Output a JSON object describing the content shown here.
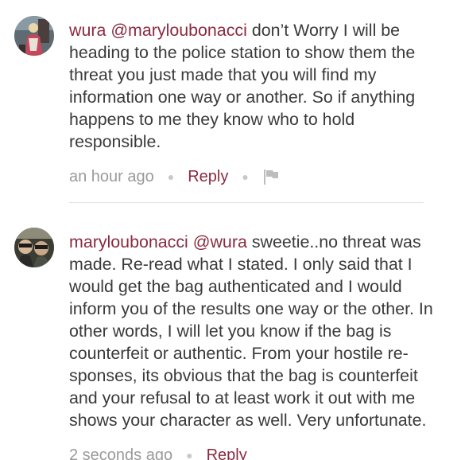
{
  "comments": [
    {
      "author": "wura",
      "mention": "@maryloubonacci",
      "text": "don’t Worry I will be heading to the police station to show them the threat you just made that you will find my information one way or another. So if anything happens to me they know who to hold responsible.",
      "time": "an hour ago",
      "reply_label": "Reply",
      "avatar_icon": "user-avatar-icon",
      "flag_icon": "flag-icon"
    },
    {
      "author": "maryloubonacci",
      "mention": "@wura",
      "text": "sweetie..no threat was made. Re-read what I stated. I only said that I would get the bag authenticated and I would inform you of the results one way or the other. In other words, I will let you know if the bag is counterfeit or authentic. From your hostile re- sponses, its obvious that the bag is counterfeit and your refusal to at least work it out with me shows your character as well. Very unfortunate.",
      "time": "2 seconds ago",
      "reply_label": "Reply",
      "avatar_icon": "user-avatar-icon"
    }
  ],
  "colors": {
    "accent": "#8a2a3e",
    "text": "#3a3a3a",
    "muted": "#9a9a9a",
    "divider": "#e2e2e2"
  }
}
